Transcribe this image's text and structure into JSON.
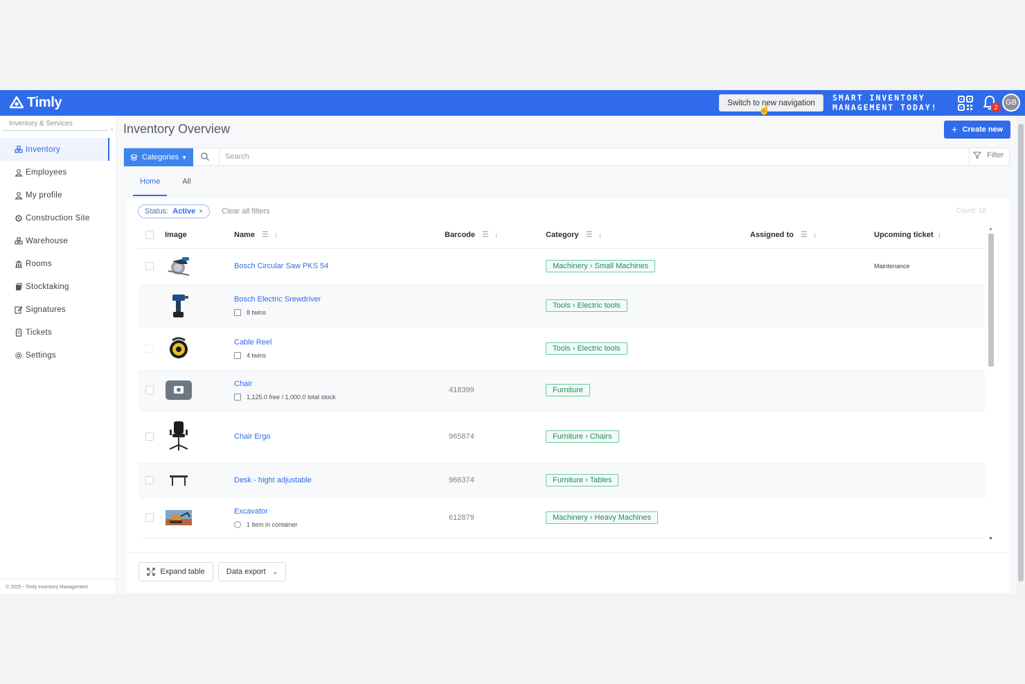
{
  "app": {
    "logo_text": "Timly",
    "switch_nav_label": "Switch to new navigation",
    "tagline_line1": "SMART INVENTORY",
    "tagline_line2": "MANAGEMENT TODAY!",
    "notification_count": "2",
    "avatar_initials": "GB",
    "brand_color": "#2f6bea"
  },
  "sidebar": {
    "header": "Inventory & Services",
    "items": [
      {
        "label": "Inventory",
        "icon": "inventory-icon"
      },
      {
        "label": "Employees",
        "icon": "person-icon"
      },
      {
        "label": "My profile",
        "icon": "person-icon"
      },
      {
        "label": "Construction Site",
        "icon": "gear-icon"
      },
      {
        "label": "Warehouse",
        "icon": "boxes-icon"
      },
      {
        "label": "Rooms",
        "icon": "building-icon"
      },
      {
        "label": "Stocktaking",
        "icon": "clipboard-icon"
      },
      {
        "label": "Signatures",
        "icon": "signature-icon"
      },
      {
        "label": "Tickets",
        "icon": "ticket-icon"
      },
      {
        "label": "Settings",
        "icon": "settings-icon"
      }
    ],
    "footer": "© 2025 - Timly Inventory Management"
  },
  "main": {
    "title": "Inventory Overview",
    "create_label": "Create new",
    "categories_label": "Categories",
    "search_placeholder": "Search",
    "filter_label": "Filter",
    "tabs": [
      {
        "label": "Home"
      },
      {
        "label": "All"
      }
    ],
    "filter_chip": {
      "key": "Status:",
      "value": "Active"
    },
    "clear_filters": "Clear all filters",
    "count": "Count: 18"
  },
  "table": {
    "headers": {
      "image": "Image",
      "name": "Name",
      "barcode": "Barcode",
      "category": "Category",
      "assigned": "Assigned to",
      "ticket": "Upcoming ticket"
    },
    "rows": [
      {
        "name": "Bosch Circular Saw PKS 54",
        "sub": "",
        "barcode": "",
        "category": "Machinery › Small Machines",
        "ticket": "Maintenance",
        "thumb": "saw"
      },
      {
        "name": "Bosch Electric Srewdriver",
        "sub": "8 twins",
        "barcode": "",
        "category": "Tools › Electric tools",
        "ticket": "",
        "thumb": "drill"
      },
      {
        "name": "Cable Reel",
        "sub": "4 twins",
        "barcode": "",
        "category": "Tools › Electric tools",
        "ticket": "",
        "thumb": "reel"
      },
      {
        "name": "Chair",
        "sub": "1,125.0 free / 1,000.0 total stock",
        "barcode": "418399",
        "category": "Furniture",
        "ticket": "",
        "thumb": "camera"
      },
      {
        "name": "Chair Ergo",
        "sub": "",
        "barcode": "965874",
        "category": "Furniture › Chairs",
        "ticket": "",
        "thumb": "chair"
      },
      {
        "name": "Desk - hight adjustable",
        "sub": "",
        "barcode": "966374",
        "category": "Furniture › Tables",
        "ticket": "",
        "thumb": "desk"
      },
      {
        "name": "Excavator",
        "sub": "1 item in container",
        "barcode": "612879",
        "category": "Machinery › Heavy Machines",
        "ticket": "",
        "thumb": "excavator"
      }
    ]
  },
  "footer": {
    "expand_label": "Expand table",
    "export_label": "Data export"
  }
}
